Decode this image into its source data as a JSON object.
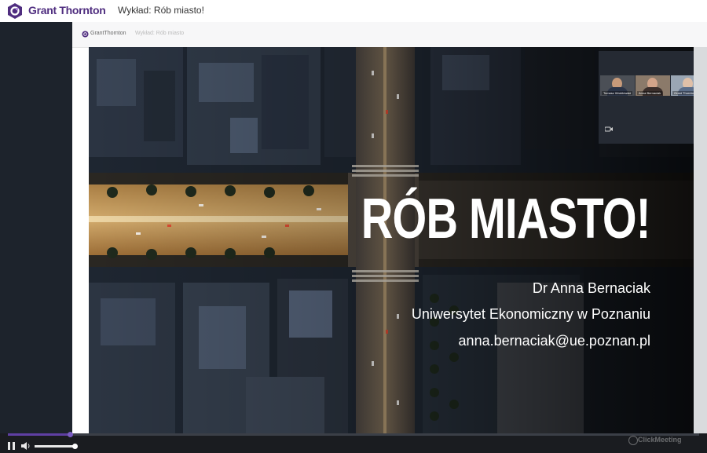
{
  "header": {
    "brand": "Grant Thornton",
    "title": "Wykład: Rób miasto!"
  },
  "inner_window": {
    "brand": "GrantThornton",
    "title": "Wykład: Rób miasto"
  },
  "slide": {
    "headline": "RÓB MIASTO!",
    "speaker": "Dr Anna Bernaciak",
    "affiliation": "Uniwersytet Ekonomiczny w Poznaniu",
    "email": "anna.bernaciak@ue.poznan.pl"
  },
  "participants": [
    {
      "name": "Tomasz Wroblewski",
      "face": "#c79a7a",
      "shirt": "#2b3447",
      "bg": "#4b4f56"
    },
    {
      "name": "Anna Bernaciak",
      "face": "#d2a48a",
      "shirt": "#3a2e2b",
      "bg": "#8b7a6a"
    },
    {
      "name": "Grant Thornton",
      "face": "#e0c0a8",
      "shirt": "#5c6e8a",
      "bg": "#9aa6b4"
    }
  ],
  "player": {
    "progress_percent": 9,
    "volume_percent": 100,
    "watermark": "ClickMeeting"
  },
  "colors": {
    "brand_purple": "#4f2d7f",
    "progress": "#5f3fa3",
    "panel_dark": "#1d232c"
  },
  "icons": {
    "logo": "grant-thornton-logo-icon",
    "pause": "pause-icon",
    "volume": "volume-icon",
    "camera": "camera-icon"
  }
}
